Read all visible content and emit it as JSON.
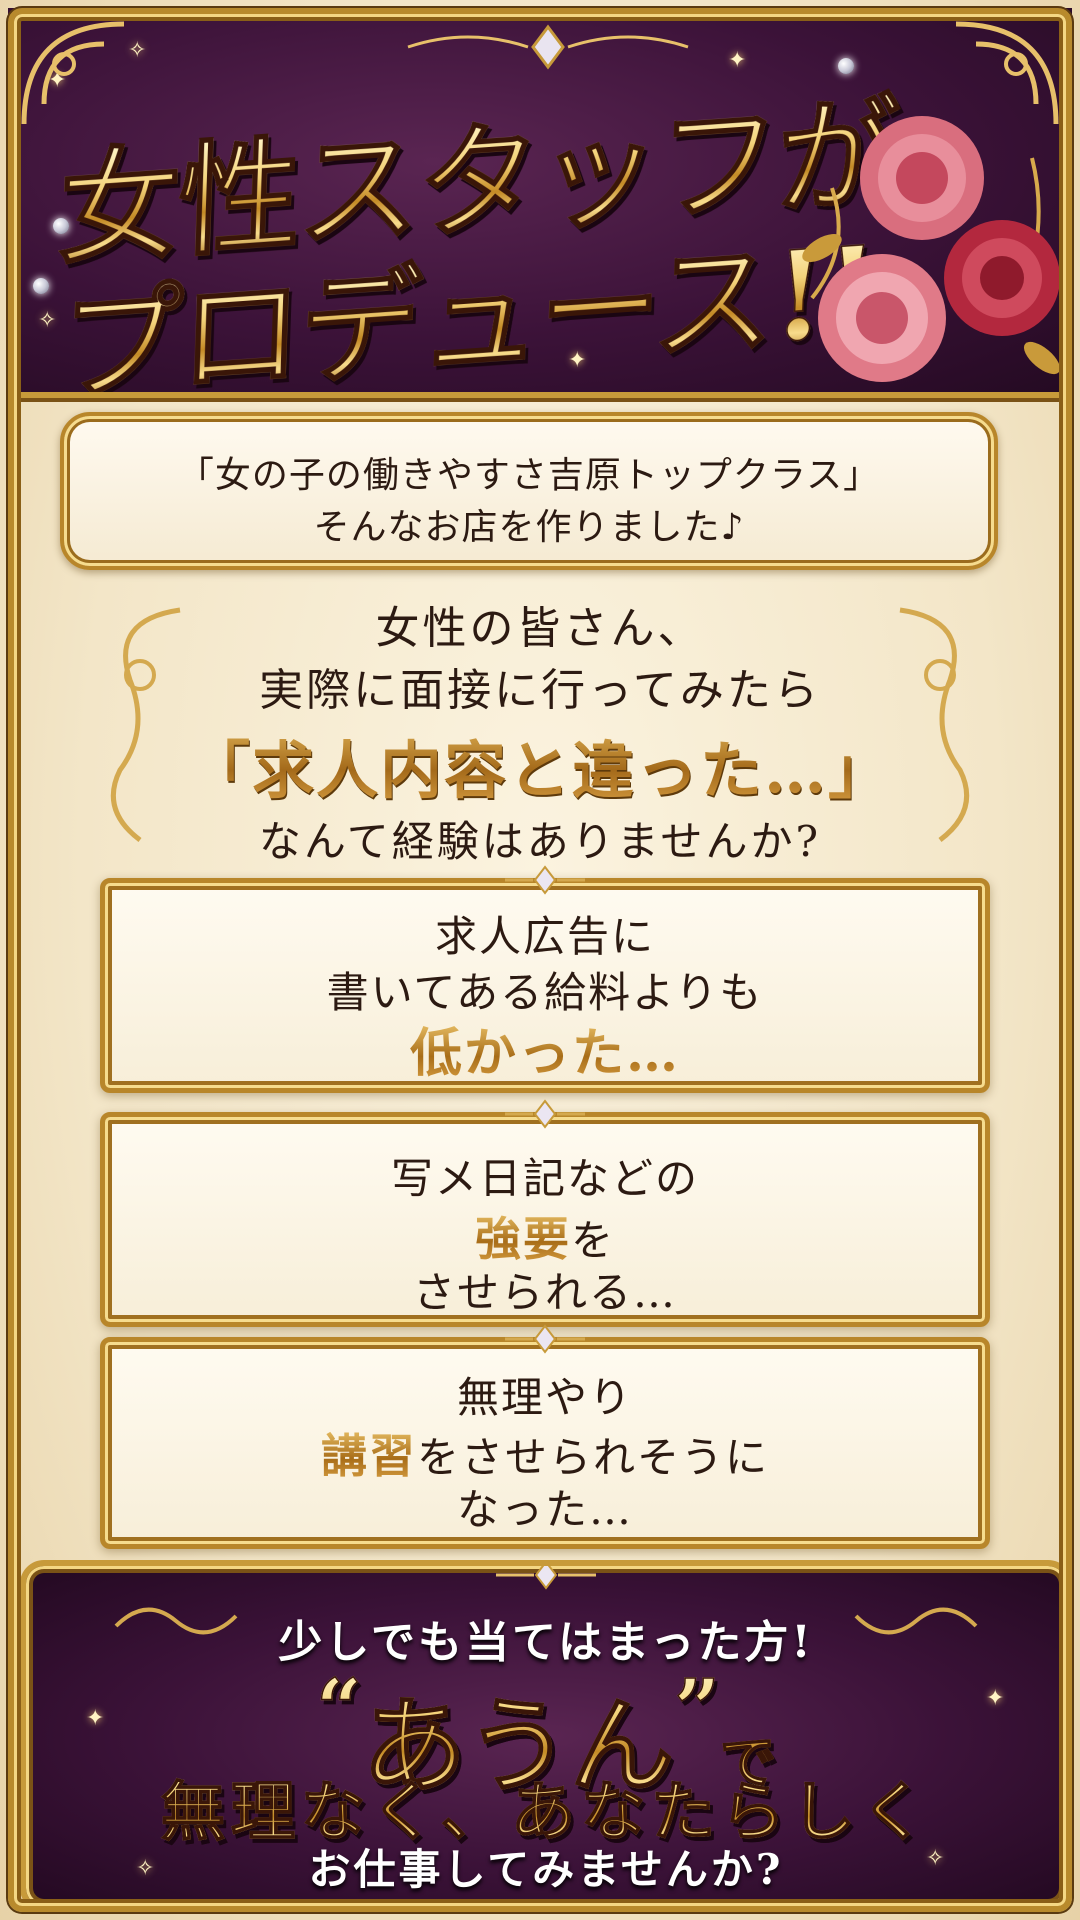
{
  "header": {
    "title_line1": "女性スタッフが",
    "title_line2": "プロデュース!!"
  },
  "intro": {
    "line1": "「女の子の働きやすさ吉原トップクラス」",
    "line2": "そんなお店を作りました♪"
  },
  "question": {
    "line1": "女性の皆さん、",
    "line2": "実際に面接に行ってみたら",
    "line3": "「求人内容と違った…」",
    "line4": "なんて経験はありませんか?"
  },
  "boxes": [
    {
      "line1": "求人広告に",
      "line2": "書いてある給料よりも",
      "line3_gold": "低かった…"
    },
    {
      "line1": "写メ日記などの",
      "line2_gold": "強要",
      "line2_rest": "を",
      "line3": "させられる…"
    },
    {
      "line1": "無理やり",
      "line2_gold": "講習",
      "line2_rest": "をさせられそうに",
      "line3": "なった…"
    }
  ],
  "footer": {
    "line1": "少しでも当てはまった方!",
    "open_quote": "“",
    "shop_name": "あうん",
    "close_quote": "”",
    "particle": "で",
    "line3": "無理なく、あなたらしく",
    "line4": "お仕事してみませんか?"
  },
  "colors": {
    "purple": "#3b1238",
    "gold": "#c79a3a",
    "cream": "#f7eed8",
    "text": "#2c1a12"
  }
}
